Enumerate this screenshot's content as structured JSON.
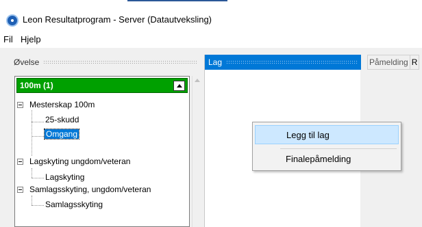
{
  "window": {
    "title": "Leon Resultatprogram - Server (Datautveksling)"
  },
  "menu": {
    "file": "Fil",
    "help": "Hjelp"
  },
  "left_panel": {
    "header": "Øvelse",
    "combo_value": "100m (1)",
    "tree": [
      {
        "label": "Mesterskap 100m",
        "children": [
          "25-skudd",
          "Omgang"
        ]
      },
      {
        "label": "Lagskyting ungdom/veteran",
        "children": [
          "Lagskyting"
        ]
      },
      {
        "label": "Samlagsskyting, ungdom/veteran",
        "children": [
          "Samlagsskyting"
        ]
      }
    ],
    "selected": "Omgang"
  },
  "mid_panel": {
    "header": "Lag"
  },
  "right_panel": {
    "tabs": [
      "Påmelding",
      "R"
    ]
  },
  "context_menu": {
    "items": [
      "Legg til lag",
      "Finalepåmelding"
    ],
    "hovered": "Legg til lag"
  },
  "colors": {
    "accent": "#0078d7",
    "combo_green": "#00a000",
    "menu_hover": "#cde8ff"
  }
}
